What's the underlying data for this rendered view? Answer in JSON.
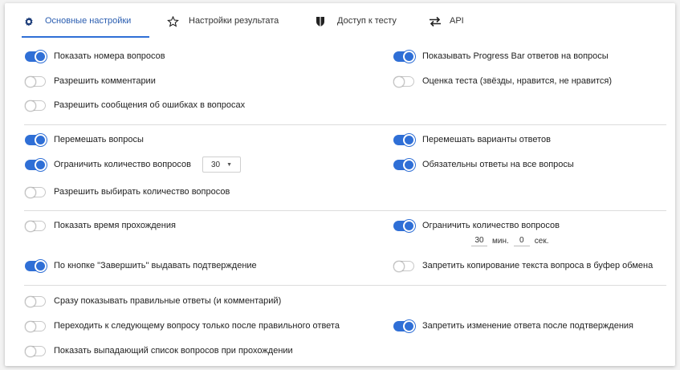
{
  "tabs": [
    {
      "label": "Основные настройки",
      "icon": "gear-icon",
      "active": true
    },
    {
      "label": "Настройки результата",
      "icon": "star-icon",
      "active": false
    },
    {
      "label": "Доступ к тесту",
      "icon": "shield-icon",
      "active": false
    },
    {
      "label": "API",
      "icon": "swap-arrows-icon",
      "active": false
    }
  ],
  "settings": {
    "show_question_numbers": {
      "label": "Показать номера вопросов",
      "on": true
    },
    "show_progress_bar": {
      "label": "Показывать Progress Bar ответов на вопросы",
      "on": true
    },
    "allow_comments": {
      "label": "Разрешить комментарии",
      "on": false
    },
    "test_rating": {
      "label": "Оценка теста (звёзды, нравится, не нравится)",
      "on": false
    },
    "allow_error_reports": {
      "label": "Разрешить сообщения об ошибках в вопросах",
      "on": false
    },
    "shuffle_questions": {
      "label": "Перемешать вопросы",
      "on": true
    },
    "shuffle_answers": {
      "label": "Перемешать варианты ответов",
      "on": true
    },
    "limit_questions": {
      "label": "Ограничить количество вопросов",
      "on": true,
      "select_value": "30"
    },
    "required_answers": {
      "label": "Обязательны ответы на все вопросы",
      "on": true
    },
    "allow_choose_count": {
      "label": "Разрешить выбирать количество вопросов",
      "on": false
    },
    "show_time": {
      "label": "Показать время прохождения",
      "on": false
    },
    "limit_time": {
      "label": "Ограничить количество вопросов",
      "on": true,
      "minutes": "30",
      "minutes_unit": "мин.",
      "seconds": "0",
      "seconds_unit": "сек."
    },
    "finish_confirm": {
      "label": "По кнопке \"Завершить\" выдавать подтверждение",
      "on": true
    },
    "forbid_copy": {
      "label": "Запретить копирование текста вопроса в буфер обмена",
      "on": false
    },
    "show_correct_immediately": {
      "label": "Сразу показывать правильные ответы (и комментарий)",
      "on": false
    },
    "next_only_after_correct": {
      "label": "Переходить к следующему вопросу только после правильного ответа",
      "on": false
    },
    "forbid_change_after_confirm": {
      "label": "Запретить изменение ответа после подтверждения",
      "on": true
    },
    "show_question_dropdown": {
      "label": "Показать выпадающий список вопросов при прохождении",
      "on": false
    }
  },
  "colors": {
    "accent": "#2f6fd6"
  }
}
